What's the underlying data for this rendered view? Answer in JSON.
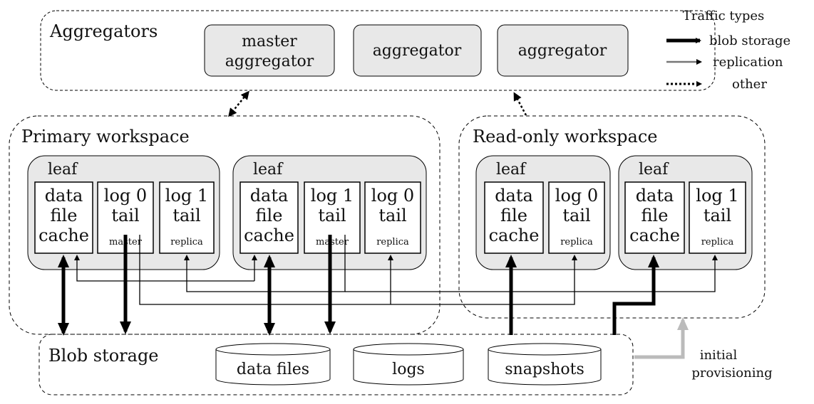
{
  "aggregators": {
    "label": "Aggregators",
    "nodes": [
      [
        "master",
        "aggregator"
      ],
      [
        "aggregator"
      ],
      [
        "aggregator"
      ]
    ]
  },
  "legend": {
    "title": "Traffic types",
    "items": [
      "blob storage",
      "replication",
      "other"
    ]
  },
  "primary": {
    "label": "Primary workspace",
    "leaves": [
      {
        "label": "leaf",
        "boxes": [
          {
            "lines": [
              "data",
              "file",
              "cache"
            ],
            "role": ""
          },
          {
            "lines": [
              "log 0",
              "tail"
            ],
            "role": "master"
          },
          {
            "lines": [
              "log 1",
              "tail"
            ],
            "role": "replica"
          }
        ]
      },
      {
        "label": "leaf",
        "boxes": [
          {
            "lines": [
              "data",
              "file",
              "cache"
            ],
            "role": ""
          },
          {
            "lines": [
              "log 1",
              "tail"
            ],
            "role": "master"
          },
          {
            "lines": [
              "log 0",
              "tail"
            ],
            "role": "replica"
          }
        ]
      }
    ]
  },
  "readonly": {
    "label": "Read-only workspace",
    "leaves": [
      {
        "label": "leaf",
        "boxes": [
          {
            "lines": [
              "data",
              "file",
              "cache"
            ],
            "role": ""
          },
          {
            "lines": [
              "log 0",
              "tail"
            ],
            "role": "replica"
          }
        ]
      },
      {
        "label": "leaf",
        "boxes": [
          {
            "lines": [
              "data",
              "file",
              "cache"
            ],
            "role": ""
          },
          {
            "lines": [
              "log 1",
              "tail"
            ],
            "role": "replica"
          }
        ]
      }
    ]
  },
  "blob": {
    "label": "Blob storage",
    "stores": [
      "data files",
      "logs",
      "snapshots"
    ]
  },
  "provisioning": [
    "initial",
    "provisioning"
  ],
  "colors": {
    "node_fill": "#e8e8e8",
    "provisioning_arrow": "#bbbbbb"
  }
}
